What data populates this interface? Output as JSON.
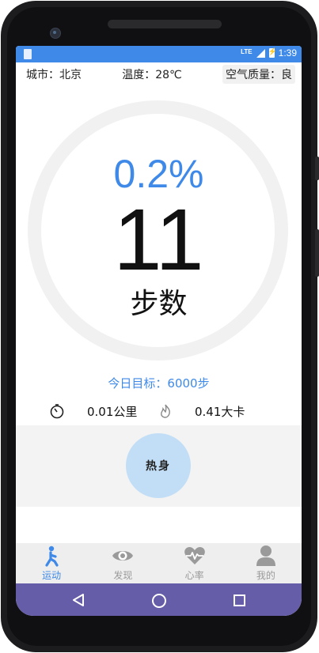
{
  "statusbar": {
    "network": "LTE",
    "time": "1:39"
  },
  "info": {
    "city": "城市：北京",
    "temperature": "温度：28℃",
    "air": "空气质量：良"
  },
  "progress": {
    "percent_text": "0.2%",
    "fraction": 0.002
  },
  "steps": {
    "count": "11",
    "unit": "步数"
  },
  "goal": {
    "text": "今日目标：6000步"
  },
  "stats": {
    "distance": "0.01公里",
    "calories": "0.41大卡"
  },
  "warmup": {
    "label": "热身"
  },
  "tabs": [
    {
      "label": "运动",
      "icon": "run-icon",
      "active": true
    },
    {
      "label": "发现",
      "icon": "eye-icon",
      "active": false
    },
    {
      "label": "心率",
      "icon": "heart-rate-icon",
      "active": false
    },
    {
      "label": "我的",
      "icon": "user-icon",
      "active": false
    }
  ],
  "colors": {
    "accent": "#3f8ae8",
    "navbar": "#665da8",
    "warmup_button": "#c2def6",
    "ring": "#f1f1f1"
  }
}
